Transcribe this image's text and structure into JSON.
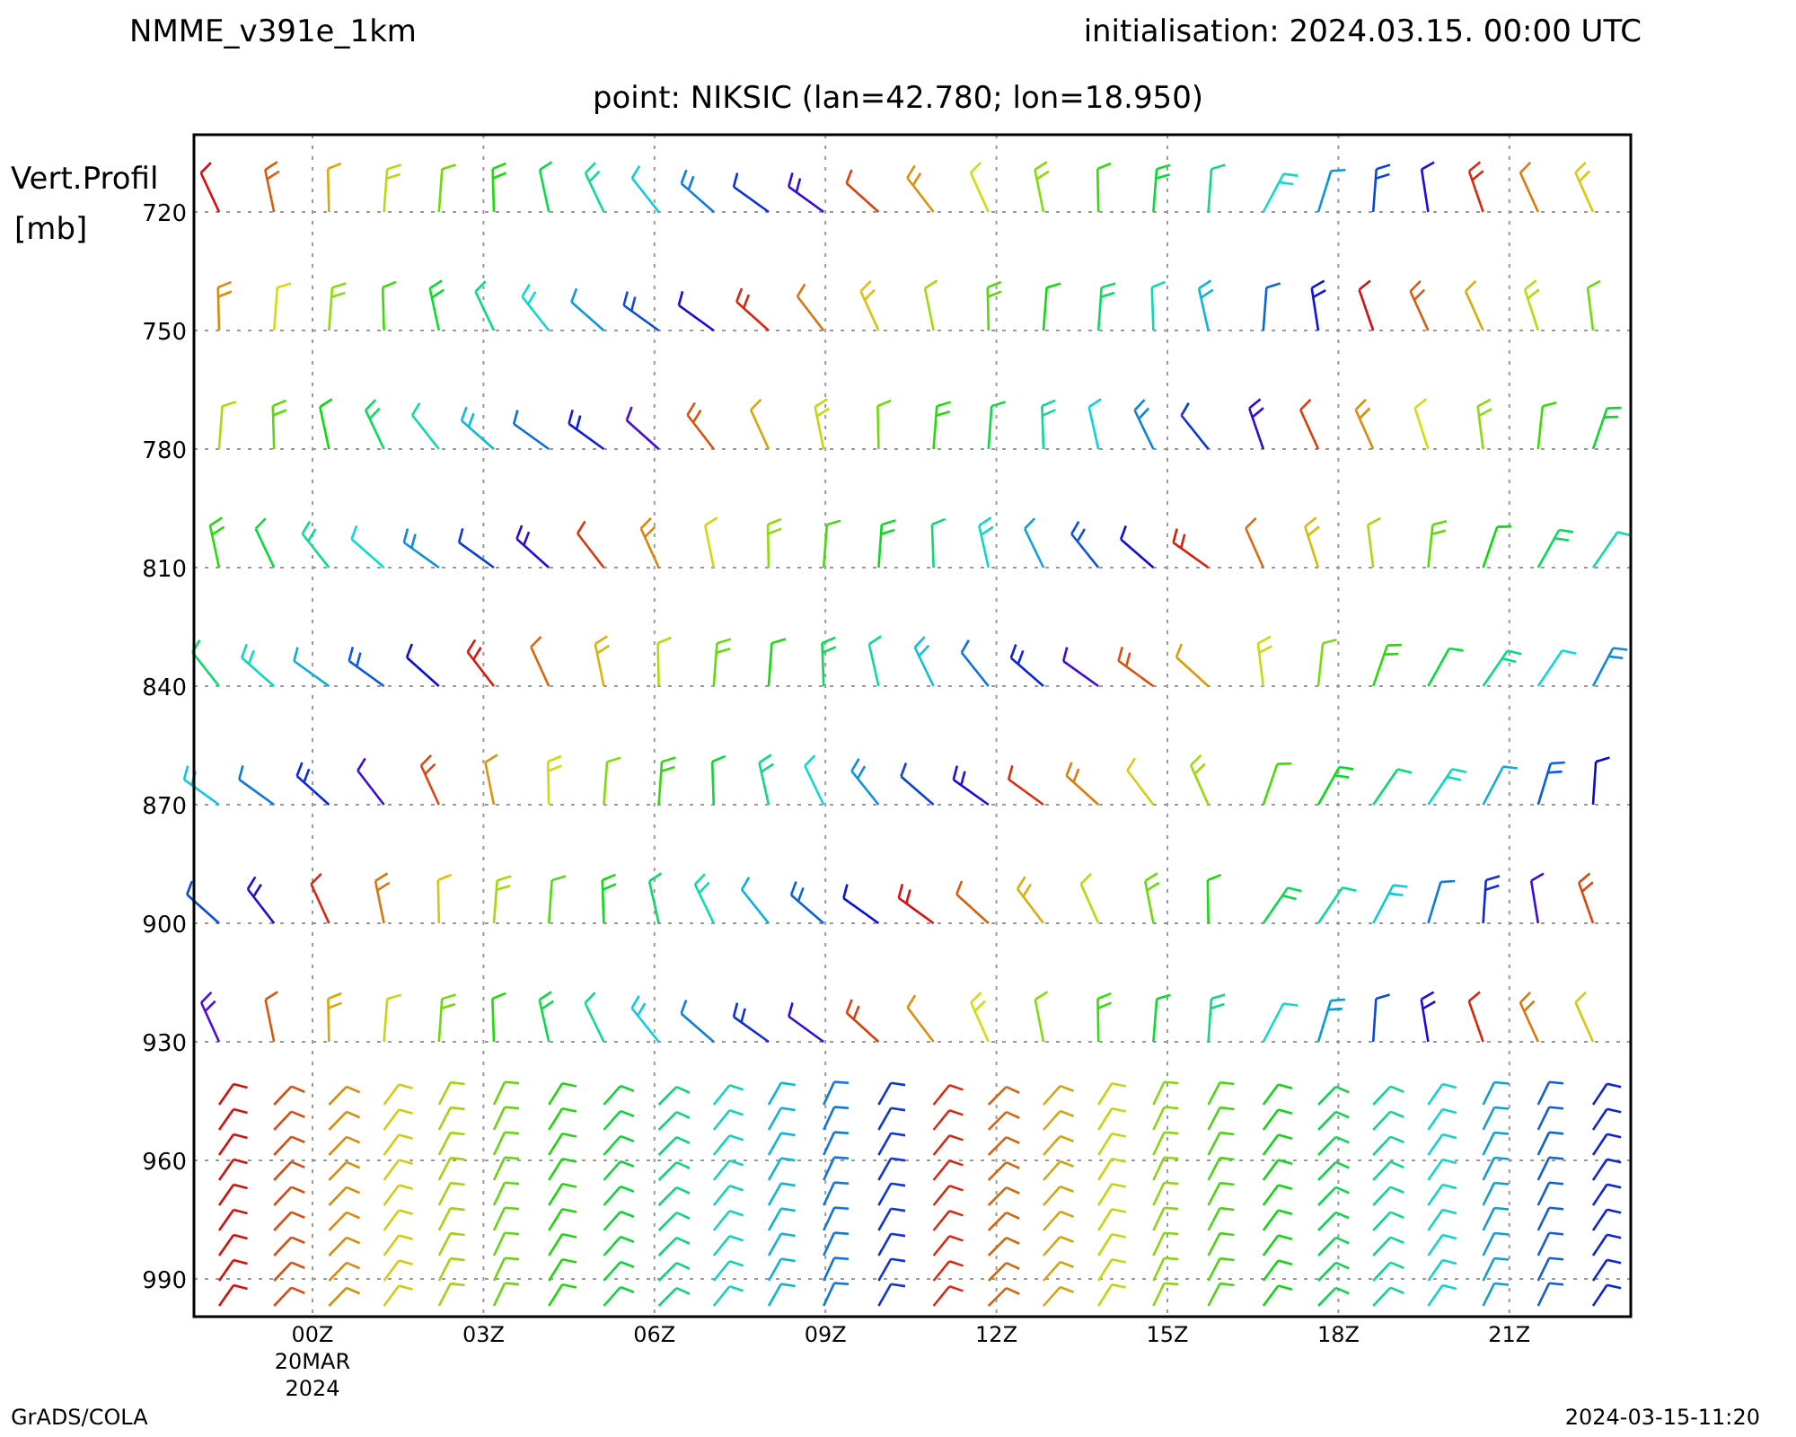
{
  "header": {
    "model": "NMME_v391e_1km",
    "initialisation": "initialisation: 2024.03.15. 00:00 UTC"
  },
  "chart": {
    "title": "point: NIKSIC (lan=42.780; lon=18.950)",
    "ylabel": "Vert.Profil",
    "yunit": "[mb]",
    "yticks": [
      "720",
      "750",
      "780",
      "810",
      "840",
      "870",
      "900",
      "930",
      "960",
      "990"
    ],
    "xticks": [
      {
        "label": "00Z",
        "date": "20MAR",
        "year": "2024"
      },
      {
        "label": "03Z"
      },
      {
        "label": "06Z"
      },
      {
        "label": "09Z"
      },
      {
        "label": "12Z"
      },
      {
        "label": "15Z"
      },
      {
        "label": "18Z"
      },
      {
        "label": "21Z"
      }
    ]
  },
  "footer": {
    "left": "GrADS/COLA",
    "right": "2024-03-15-11:20"
  }
}
